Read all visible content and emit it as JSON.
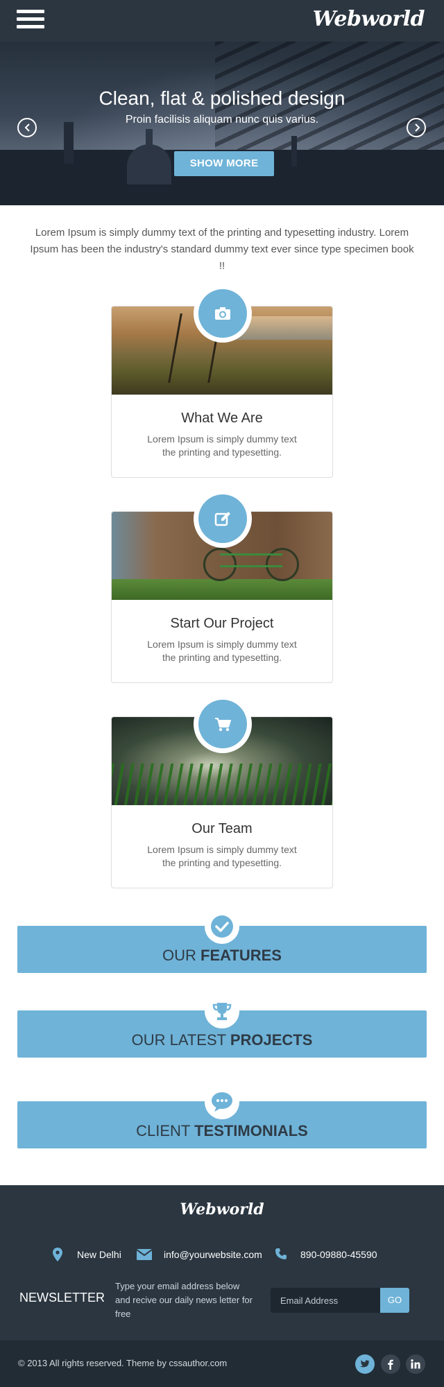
{
  "header": {
    "logo": "Webworld",
    "menu_icon": "hamburger-menu-icon"
  },
  "hero": {
    "title": "Clean, flat & polished design",
    "subtitle": "Proin facilisis aliquam nunc quis varius.",
    "button_label": "SHOW MORE",
    "prev_icon": "chevron-left-circle-icon",
    "next_icon": "chevron-right-circle-icon"
  },
  "intro": {
    "text": "Lorem Ipsum is simply dummy text of the printing and typesetting industry. Lorem Ipsum has been the industry's standard dummy text ever since type specimen book !!"
  },
  "cards": [
    {
      "title": "What We Are",
      "text": "Lorem Ipsum is simply dummy text the printing and typesetting.",
      "icon": "camera-icon"
    },
    {
      "title": "Start Our Project",
      "text": "Lorem Ipsum is simply dummy text the printing and typesetting.",
      "icon": "edit-icon"
    },
    {
      "title": "Our Team",
      "text": "Lorem Ipsum is simply dummy text the printing and typesetting.",
      "icon": "cart-icon"
    }
  ],
  "bands": [
    {
      "light": "OUR ",
      "bold": "FEATURES",
      "icon": "check-circle-icon"
    },
    {
      "light": "OUR LATEST ",
      "bold": "PROJECTS",
      "icon": "trophy-icon"
    },
    {
      "light": "CLIENT ",
      "bold": "TESTIMONIALS",
      "icon": "chat-bubble-icon"
    }
  ],
  "footer": {
    "logo": "Webworld",
    "location": "New Delhi",
    "email": "info@yourwebsite.com",
    "phone": "890-09880-45590",
    "newsletter_title": "NEWSLETTER",
    "newsletter_desc": "Type your email address below and recive our daily news letter for free",
    "email_placeholder": "Email Address",
    "go_label": "GO",
    "copyright": "© 2013 All rights reserved.  Theme by cssauthor.com",
    "social": [
      "twitter-icon",
      "facebook-icon",
      "linkedin-icon"
    ]
  },
  "colors": {
    "accent": "#6fb3d8",
    "dark": "#2b3640",
    "darker": "#222c35"
  }
}
